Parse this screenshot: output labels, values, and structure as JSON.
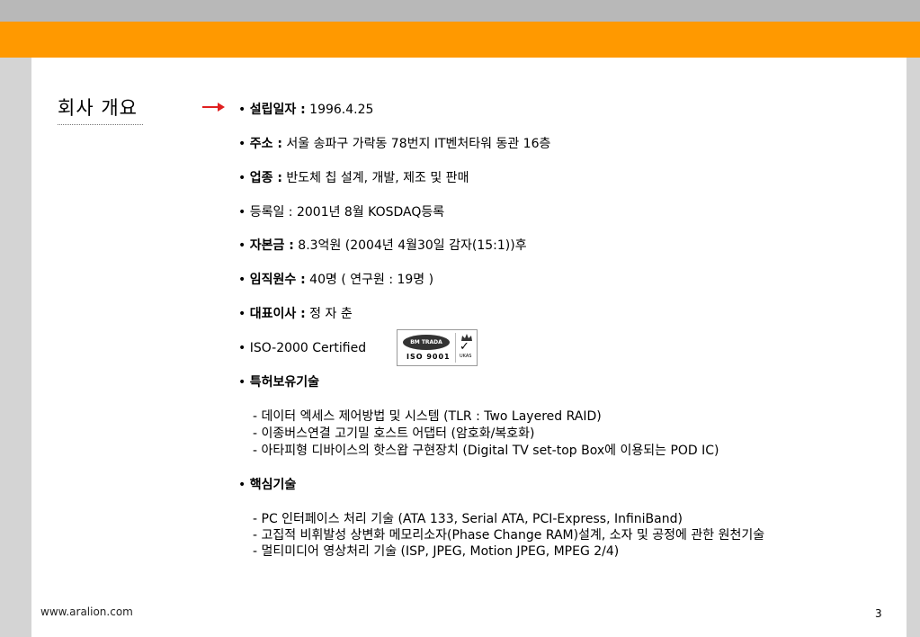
{
  "section_title": "회사 개요",
  "items": [
    {
      "label": "설립일자 :",
      "value": " 1996.4.25"
    },
    {
      "label": "주소 :",
      "value": " 서울 송파구 가락동 78번지 IT벤처타워 동관 16층"
    },
    {
      "label": "업종 :",
      "value": " 반도체 칩 설계, 개발, 제조 및 판매"
    },
    {
      "label": "",
      "value": "등록일 : 2001년 8월 KOSDAQ등록"
    },
    {
      "label": "자본금 :",
      "value": "  8.3억원 (2004년 4월30일 감자(15:1))후"
    },
    {
      "label": "임직원수 :",
      "value": " 40명 ( 연구원 : 19명 )"
    },
    {
      "label": "대표이사 :",
      "value": " 정 자 춘"
    },
    {
      "label": "",
      "value": "ISO-2000 Certified"
    },
    {
      "label": "특허보유기술",
      "value": ""
    }
  ],
  "patents": [
    "- 데이터 엑세스 제어방법 및 시스템 (TLR : Two Layered RAID)",
    "- 이종버스연결 고기밀 호스트 어댑터 (암호화/복호화)",
    "- 아타피형 디바이스의 핫스왑 구현장치 (Digital TV set-top Box에 이용되는 POD IC)"
  ],
  "core_tech_label": "핵심기술",
  "core_tech": [
    "- PC 인터페이스 처리 기술 (ATA 133, Serial ATA, PCI-Express, InfiniBand)",
    "- 고집적 비휘발성 상변화 메모리소자(Phase Change RAM)설계, 소자 및 공정에 관한 원천기술",
    "- 멀티미디어 영상처리 기술 (ISP, JPEG, Motion JPEG, MPEG 2/4)"
  ],
  "iso_logo": {
    "bm_text": "BM TRADA",
    "iso_text": "ISO 9001",
    "ukas_text": "UKAS"
  },
  "footer": {
    "url": "www.aralion.com",
    "page": "3"
  },
  "colors": {
    "accent": "#ff9900",
    "arrow": "#e02020",
    "header_gray": "#b8b8b8",
    "side_gray": "#d4d4d4"
  }
}
